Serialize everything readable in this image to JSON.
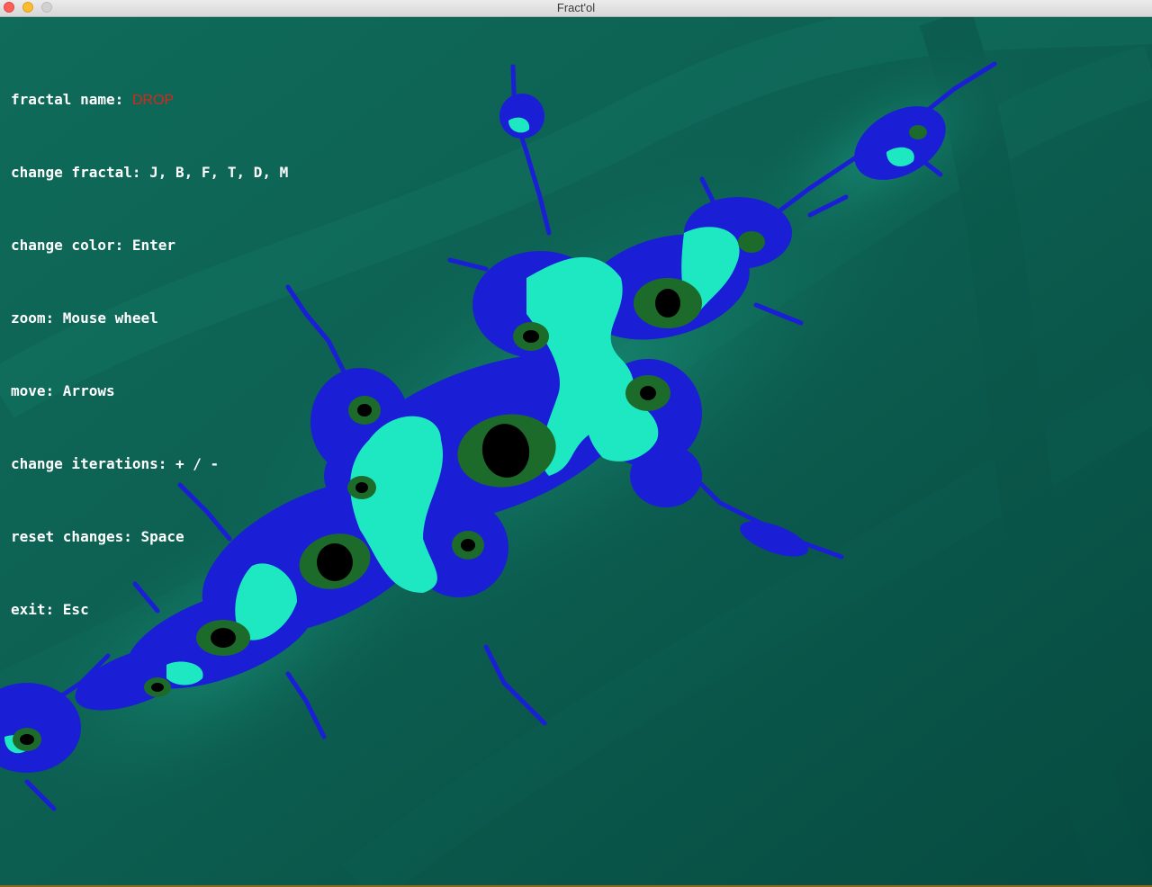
{
  "window": {
    "title": "Fract'ol"
  },
  "hud": {
    "fractal_name_label": "fractal name: ",
    "fractal_name_value": "DROP",
    "fractal_name_value_color": "#d8261c",
    "lines": [
      "change fractal: J, B, F, T, D, M",
      "change color: Enter",
      "zoom: Mouse wheel",
      "move: Arrows",
      "change iterations: + / -",
      "reset changes: Space",
      "exit: Esc"
    ]
  },
  "colors": {
    "background": "#0b5a4d",
    "light_cyan": "#1de8c2",
    "blue": "#1a1fd6",
    "dark_green": "#1d6b2a",
    "black": "#000000"
  }
}
